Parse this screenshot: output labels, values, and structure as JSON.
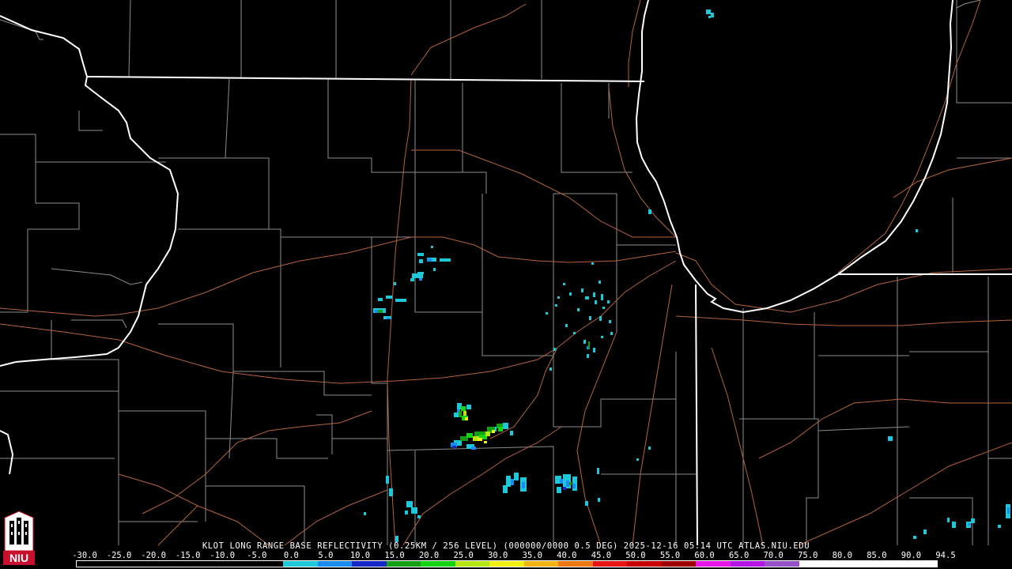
{
  "product": {
    "caption": "KLOT LONG RANGE BASE REFLECTIVITY (0.25KM / 256 LEVEL) (000000/0000 0.5 DEG) 2025-12-16 05:14 UTC  ATLAS.NIU.EDU"
  },
  "logo": {
    "text": "NIU",
    "icon": "niu-castle-logo-icon",
    "color": "#c8102e"
  },
  "scale": {
    "labels": [
      "-30.0",
      "-25.0",
      "-20.0",
      "-15.0",
      "-10.0",
      "-5.0",
      "0.0",
      "5.0",
      "10.0",
      "15.0",
      "20.0",
      "25.0",
      "30.0",
      "35.0",
      "40.0",
      "45.0",
      "50.0",
      "55.0",
      "60.0",
      "65.0",
      "70.0",
      "75.0",
      "80.0",
      "85.0",
      "90.0",
      "94.5"
    ],
    "colors": [
      "#000000",
      "#000000",
      "#000000",
      "#000000",
      "#000000",
      "#000000",
      "#1ec8d8",
      "#1a8cf0",
      "#1428c8",
      "#14a014",
      "#14d214",
      "#b4e614",
      "#f0f014",
      "#f0b414",
      "#f07814",
      "#e61414",
      "#c80000",
      "#a00000",
      "#e614e6",
      "#b414e6",
      "#9650c8",
      "#ffffff",
      "#ffffff",
      "#ffffff",
      "#ffffff"
    ]
  },
  "colors": {
    "state_lines": "#ffffff",
    "county_lines": "#8c8c8c",
    "roads": "#b4643c",
    "lake_shore": "#ffffff"
  }
}
